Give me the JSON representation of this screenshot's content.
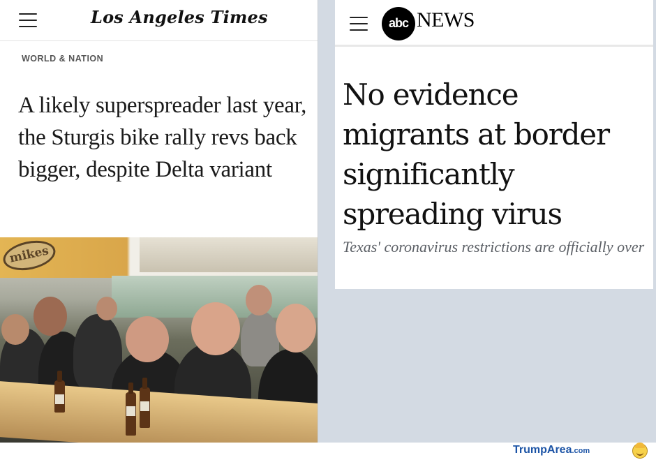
{
  "left_panel": {
    "logo": "Los Angeles Times",
    "section": "WORLD & NATION",
    "headline": "A likely superspreader last year, the Sturgis bike rally revs back bigger, despite Delta variant",
    "photo": {
      "sign_text": "mikes"
    }
  },
  "right_panel": {
    "logo_mark": "abc",
    "logo_word": "NEWS",
    "headline": "No evidence migrants at border significantly spreading virus",
    "subheadline": "Texas' coronavirus restrictions are officially over"
  },
  "watermark": {
    "brand": "TrumpArea",
    "suffix": ".com"
  },
  "colors": {
    "background_right": "#d3dae3",
    "watermark_blue": "#1c54a6"
  }
}
